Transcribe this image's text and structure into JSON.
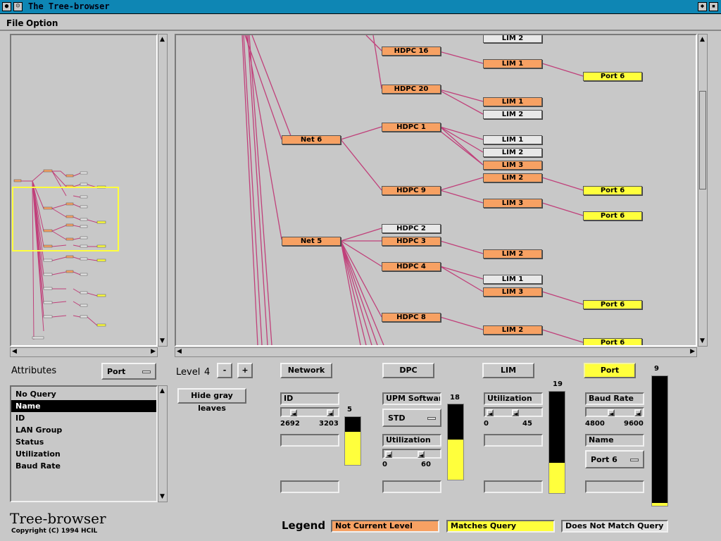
{
  "window": {
    "title": "The Tree-browser"
  },
  "menu": {
    "file": "File",
    "option": "Option"
  },
  "colors": {
    "not_current_level": "#f7a163",
    "matches_query": "#ffff3c",
    "does_not_match": "#e8e8e8",
    "edge": "#c0407a",
    "viewport_box": "#ffff3c"
  },
  "tree": {
    "nodes": [
      {
        "id": "lim2top",
        "label": "LIM 2",
        "color": "gray"
      },
      {
        "id": "hdpc16",
        "label": "HDPC 16",
        "color": "orange"
      },
      {
        "id": "lim1a",
        "label": "LIM 1",
        "color": "orange"
      },
      {
        "id": "port6a",
        "label": "Port 6",
        "color": "yellow"
      },
      {
        "id": "hdpc20",
        "label": "HDPC 20",
        "color": "orange"
      },
      {
        "id": "lim1b",
        "label": "LIM 1",
        "color": "orange"
      },
      {
        "id": "lim2b",
        "label": "LIM 2",
        "color": "gray"
      },
      {
        "id": "net6",
        "label": "Net 6",
        "color": "orange"
      },
      {
        "id": "hdpc1",
        "label": "HDPC 1",
        "color": "orange"
      },
      {
        "id": "lim1c",
        "label": "LIM 1",
        "color": "gray"
      },
      {
        "id": "lim2c",
        "label": "LIM 2",
        "color": "gray"
      },
      {
        "id": "lim3c",
        "label": "LIM 3",
        "color": "orange"
      },
      {
        "id": "lim2d",
        "label": "LIM 2",
        "color": "orange"
      },
      {
        "id": "hdpc9",
        "label": "HDPC 9",
        "color": "orange"
      },
      {
        "id": "port6b",
        "label": "Port 6",
        "color": "yellow"
      },
      {
        "id": "lim3d",
        "label": "LIM 3",
        "color": "orange"
      },
      {
        "id": "port6c",
        "label": "Port 6",
        "color": "yellow"
      },
      {
        "id": "hdpc2",
        "label": "HDPC 2",
        "color": "gray"
      },
      {
        "id": "net5",
        "label": "Net 5",
        "color": "orange"
      },
      {
        "id": "hdpc3",
        "label": "HDPC 3",
        "color": "orange"
      },
      {
        "id": "lim2e",
        "label": "LIM 2",
        "color": "orange"
      },
      {
        "id": "hdpc4",
        "label": "HDPC 4",
        "color": "orange"
      },
      {
        "id": "lim1f",
        "label": "LIM 1",
        "color": "gray"
      },
      {
        "id": "lim3f",
        "label": "LIM 3",
        "color": "orange"
      },
      {
        "id": "port6d",
        "label": "Port 6",
        "color": "yellow"
      },
      {
        "id": "hdpc8",
        "label": "HDPC 8",
        "color": "orange"
      },
      {
        "id": "lim2g",
        "label": "LIM 2",
        "color": "orange"
      },
      {
        "id": "port6e",
        "label": "Port 6",
        "color": "yellow"
      }
    ]
  },
  "attributes": {
    "label": "Attributes",
    "selector": "Port",
    "items": [
      "No Query",
      "Name",
      "ID",
      "LAN Group",
      "Status",
      "Utilization",
      "Baud Rate"
    ],
    "selected": "Name"
  },
  "branding": {
    "name": "Tree-browser",
    "copyright": "Copyright (C) 1994 HCIL"
  },
  "level": {
    "label": "Level",
    "value": "4",
    "minus": "-",
    "plus": "+",
    "hide_button": "Hide gray leaves"
  },
  "columns": {
    "network": {
      "title": "Network",
      "field1": "ID",
      "slider_min": "2692",
      "slider_max": "3203",
      "count": "5",
      "bar_fill_fraction": 0.69
    },
    "dpc": {
      "title": "DPC",
      "field1": "UPM Softwar",
      "select": "STD",
      "field2": "Utilization",
      "slider_min": "0",
      "slider_max": "60",
      "count": "18",
      "bar_fill_fraction": 0.53
    },
    "lim": {
      "title": "LIM",
      "field1": "Utilization",
      "slider_min": "0",
      "slider_max": "45",
      "count": "19",
      "bar_fill_fraction": 0.3
    },
    "port": {
      "title": "Port",
      "field1": "Baud Rate",
      "slider_min": "4800",
      "slider_max": "9600",
      "field2": "Name",
      "select": "Port 6",
      "count": "9",
      "bar_fill_fraction": 0.02
    }
  },
  "legend": {
    "title": "Legend",
    "not_current": "Not Current Level",
    "matches": "Matches Query",
    "not_match": "Does Not Match Query"
  }
}
